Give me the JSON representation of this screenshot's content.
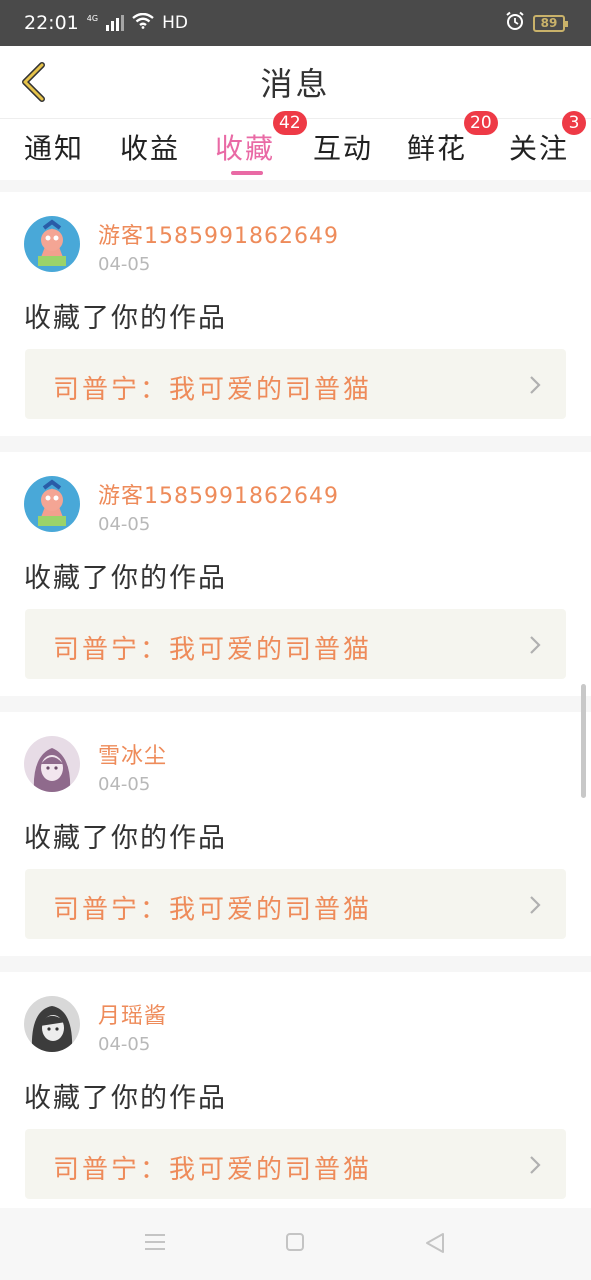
{
  "status_bar": {
    "time": "22:01",
    "network": "4G",
    "hd": "HD",
    "battery": "89"
  },
  "header": {
    "title": "消息"
  },
  "tabs": [
    {
      "label": "通知",
      "badge": ""
    },
    {
      "label": "收益",
      "badge": ""
    },
    {
      "label": "收藏",
      "badge": "42",
      "active": true
    },
    {
      "label": "互动",
      "badge": ""
    },
    {
      "label": "鲜花",
      "badge": "20"
    },
    {
      "label": "关注",
      "badge": "3"
    }
  ],
  "messages": [
    {
      "user": "游客1585991862649",
      "date": "04-05",
      "action": "收藏了你的作品",
      "work": "司普宁：我可爱的司普猫",
      "avatar": "patrick-star-avatar"
    },
    {
      "user": "游客1585991862649",
      "date": "04-05",
      "action": "收藏了你的作品",
      "work": "司普宁：我可爱的司普猫",
      "avatar": "patrick-star-avatar"
    },
    {
      "user": "雪冰尘",
      "date": "04-05",
      "action": "收藏了你的作品",
      "work": "司普宁：我可爱的司普猫",
      "avatar": "anime-girl-avatar"
    },
    {
      "user": "月瑶酱",
      "date": "04-05",
      "action": "收藏了你的作品",
      "work": "司普宁：我可爱的司普猫",
      "avatar": "grayscale-girl-avatar"
    }
  ],
  "colors": {
    "accent": "#e96aa5",
    "username": "#ee8b5a",
    "badge": "#ee3a46",
    "back_arrow": "#d9b23a"
  },
  "icons": {
    "back": "chevron-left-icon",
    "work_arrow": "chevron-right-icon",
    "nav_menu": "menu-icon",
    "nav_home": "square-icon",
    "nav_back": "triangle-back-icon"
  }
}
